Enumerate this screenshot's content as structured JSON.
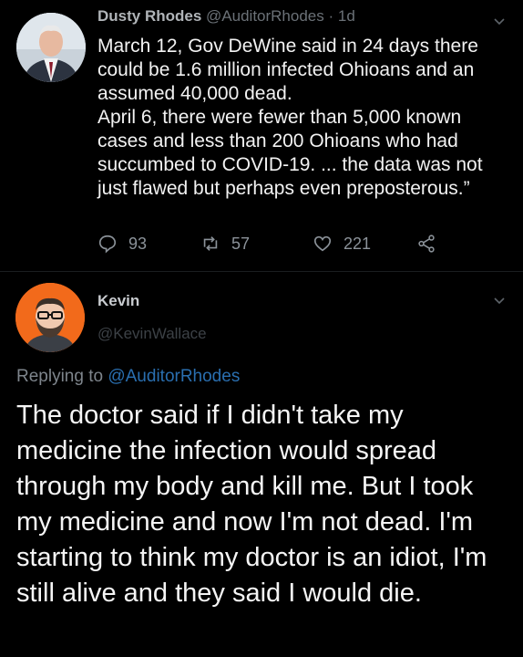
{
  "tweet1": {
    "name": "Dusty Rhodes",
    "handle": "@AuditorRhodes",
    "time": "1d",
    "avatar_icon": "avatar-photo-man-suit-icon",
    "body": [
      "March 12, Gov DeWine said in 24 days there could be 1.6 million infected Ohioans and an assumed 40,000 dead.",
      "April 6, there were fewer than 5,000 known cases and less than 200 Ohioans who had succumbed to COVID-19. ... the data was not just flawed but perhaps even preposterous.”"
    ],
    "actions": {
      "replies": "93",
      "retweets": "57",
      "likes": "221"
    }
  },
  "tweet2": {
    "name": "Kevin",
    "handle": "@KevinWallace",
    "avatar_icon": "avatar-illustration-bearded-man-icon",
    "replying_prefix": "Replying to",
    "replying_to": "@AuditorRhodes",
    "body": "The doctor said if I didn't take my medicine the infection would spread through my body and kill me. But I took my medicine and now I'm not dead. I'm starting to think my doctor is an idiot, I'm still alive and they said I would die."
  },
  "colors": {
    "background": "#000000",
    "muted_text": "#8b9299",
    "link": "#2a6fb0",
    "avatar2_bg": "#f26a1b"
  }
}
